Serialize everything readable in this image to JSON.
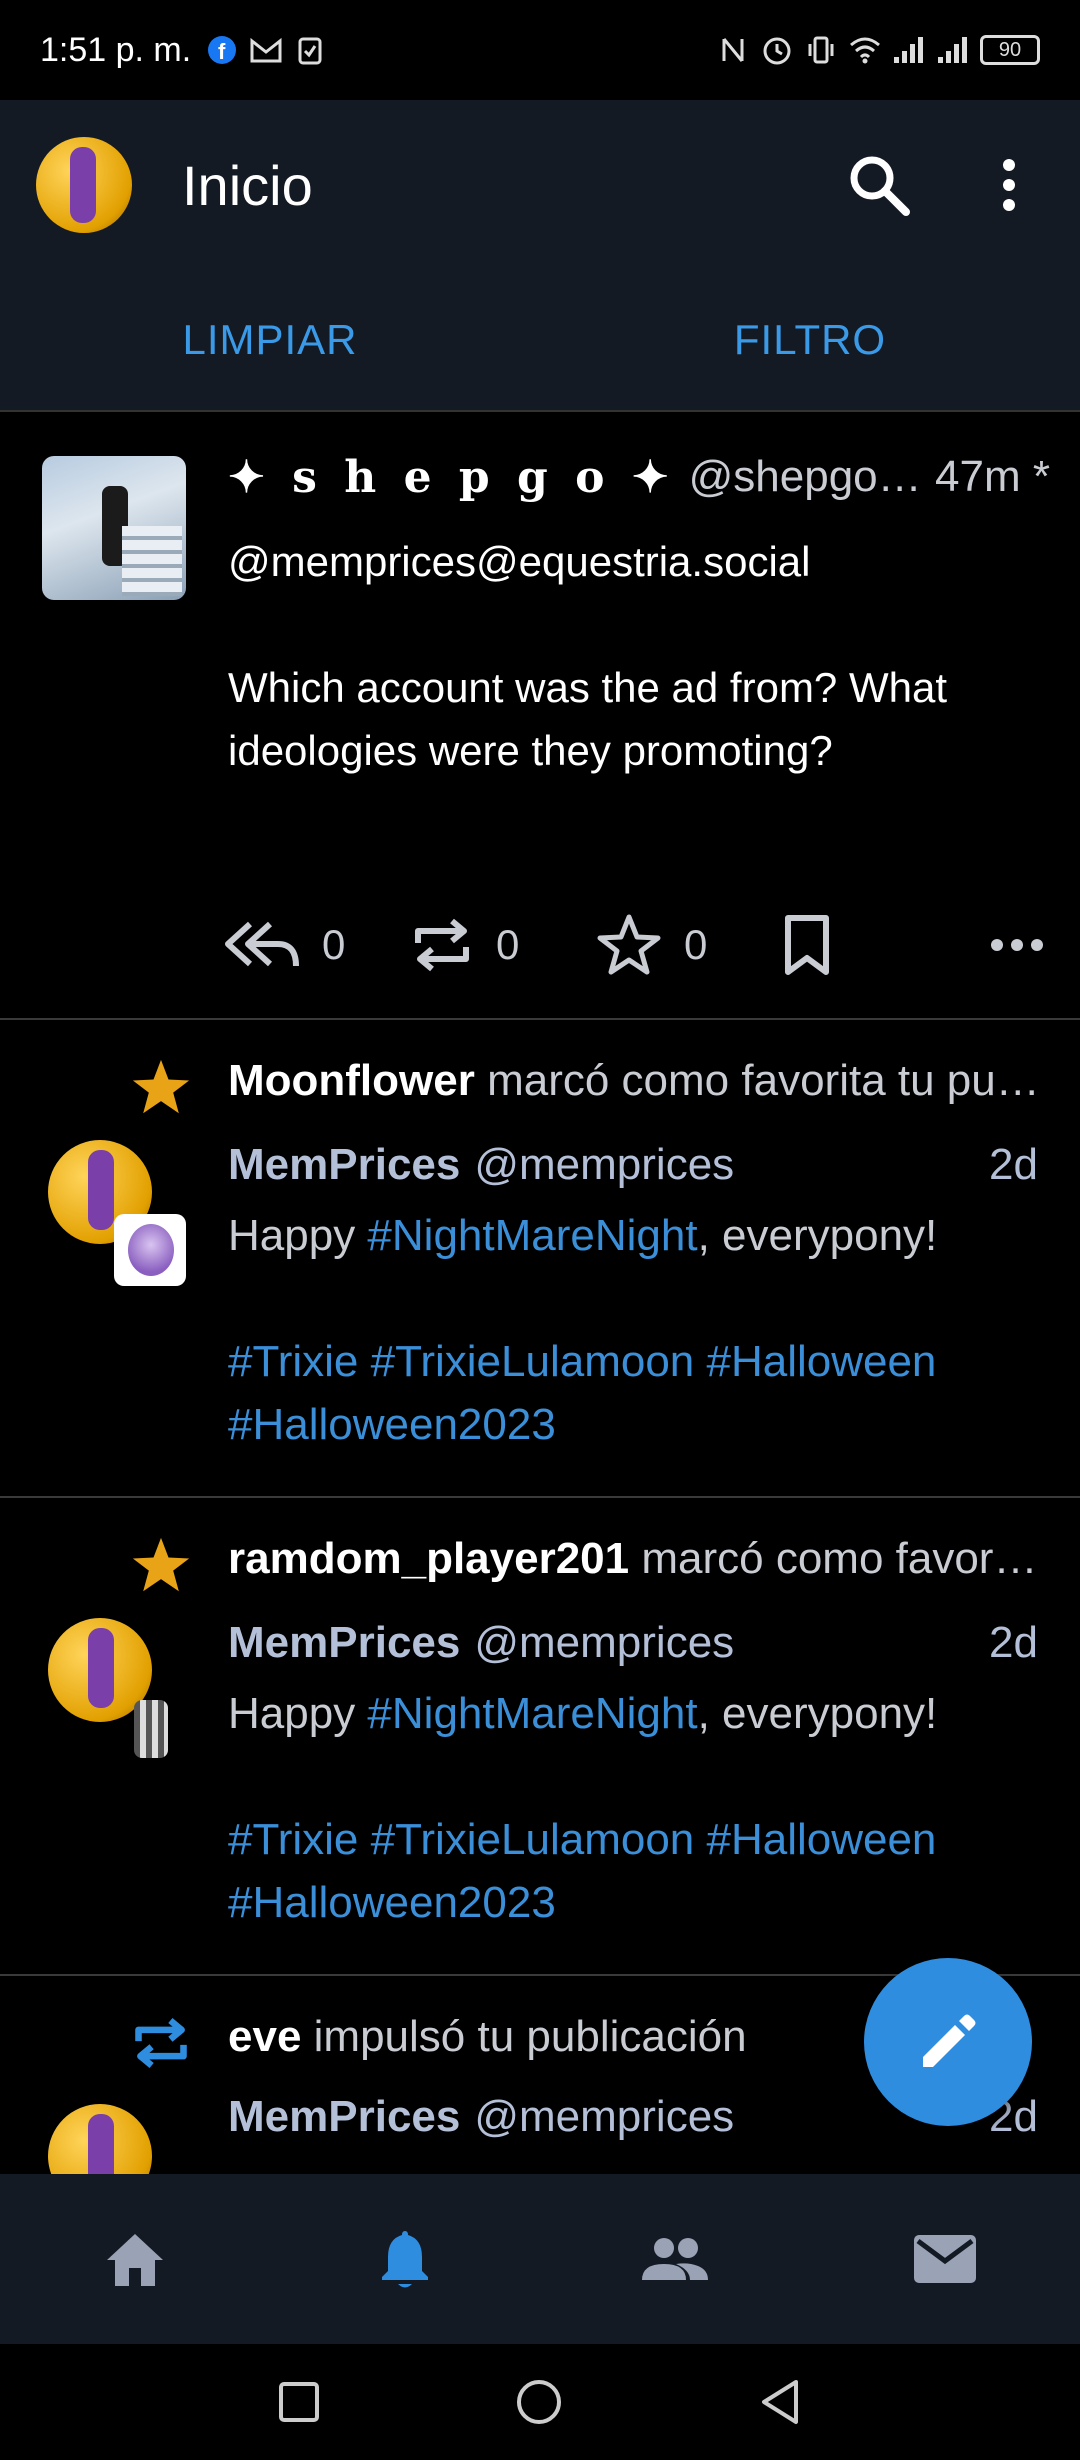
{
  "status_bar": {
    "time": "1:51 p. m.",
    "battery": "90",
    "left_icons": [
      "facebook-icon",
      "gmail-icon",
      "clipboard-icon"
    ],
    "right_icons": [
      "nfc-icon",
      "alarm-icon",
      "vibrate-icon",
      "wifi-icon",
      "signal-icon",
      "signal-icon"
    ]
  },
  "header": {
    "title": "Inicio",
    "search_icon": "search-icon",
    "menu_icon": "more-vert-icon"
  },
  "filter_bar": {
    "clear_label": "LIMPIAR",
    "filter_label": "FILTRO"
  },
  "colors": {
    "accent": "#2f8de0",
    "link": "#3a8fd8",
    "star": "#e8a317",
    "bar_bg": "#141a24"
  },
  "post": {
    "author_name": "✦ s h e p g o ✦",
    "author_handle": "@shepgo@m…",
    "time": "47m *",
    "mention": "@memprices@equestria.social",
    "body": "Which account was the ad from? What ideologies were they promoting?",
    "replies": "0",
    "boosts": "0",
    "favourites": "0"
  },
  "notifications": [
    {
      "kind": "favourite",
      "actor": "Moonflower",
      "action": " marcó como favorita tu publicación",
      "author_name": "MemPrices",
      "author_handle": "@memprices",
      "time": "2d",
      "text_pre": "Happy ",
      "text_tag": "#NightMareNight",
      "text_post": ", everypony!",
      "tags": "#Trixie #TrixieLulamoon #Halloween #Halloween2023"
    },
    {
      "kind": "favourite",
      "actor": "ramdom_player201",
      "action": " marcó como favorita tu publicación",
      "author_name": "MemPrices",
      "author_handle": "@memprices",
      "time": "2d",
      "text_pre": "Happy ",
      "text_tag": "#NightMareNight",
      "text_post": ", everypony!",
      "tags": "#Trixie #TrixieLulamoon #Halloween #Halloween2023"
    },
    {
      "kind": "boost",
      "actor": "eve",
      "action": " impulsó tu publicación",
      "author_name": "MemPrices",
      "author_handle": "@memprices",
      "time": "2d"
    }
  ],
  "bottom_tabs": [
    "home-icon",
    "notifications-icon",
    "people-icon",
    "mail-icon"
  ],
  "nav_bar": [
    "recents-icon",
    "home-circle-icon",
    "back-icon"
  ]
}
